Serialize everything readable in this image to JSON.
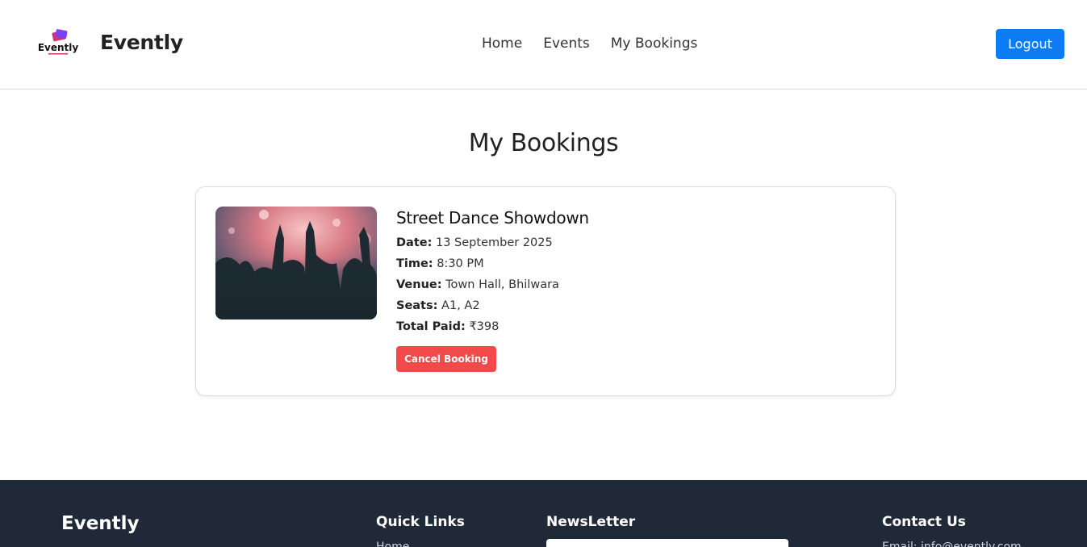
{
  "header": {
    "logo_text": "Evently",
    "brand": "Evently",
    "nav": [
      "Home",
      "Events",
      "My Bookings"
    ],
    "logout_label": "Logout"
  },
  "main": {
    "title": "My Bookings",
    "bookings": [
      {
        "event_name": "Street Dance Showdown",
        "date_label": "Date:",
        "date": "13 September 2025",
        "time_label": "Time:",
        "time": "8:30 PM",
        "venue_label": "Venue:",
        "venue": "Town Hall, Bhilwara",
        "seats_label": "Seats:",
        "seats": "A1, A2",
        "total_label": "Total Paid:",
        "total": "₹398",
        "cancel_label": "Cancel Booking"
      }
    ]
  },
  "footer": {
    "brand": "Evently",
    "quick_links_title": "Quick Links",
    "quick_links": [
      "Home"
    ],
    "newsletter_title": "NewsLetter",
    "contact_title": "Contact Us",
    "contact_email": "Email: info@evently.com"
  },
  "colors": {
    "primary": "#0d7cf2",
    "danger": "#f24a4a",
    "footer_bg": "#1f2937"
  }
}
